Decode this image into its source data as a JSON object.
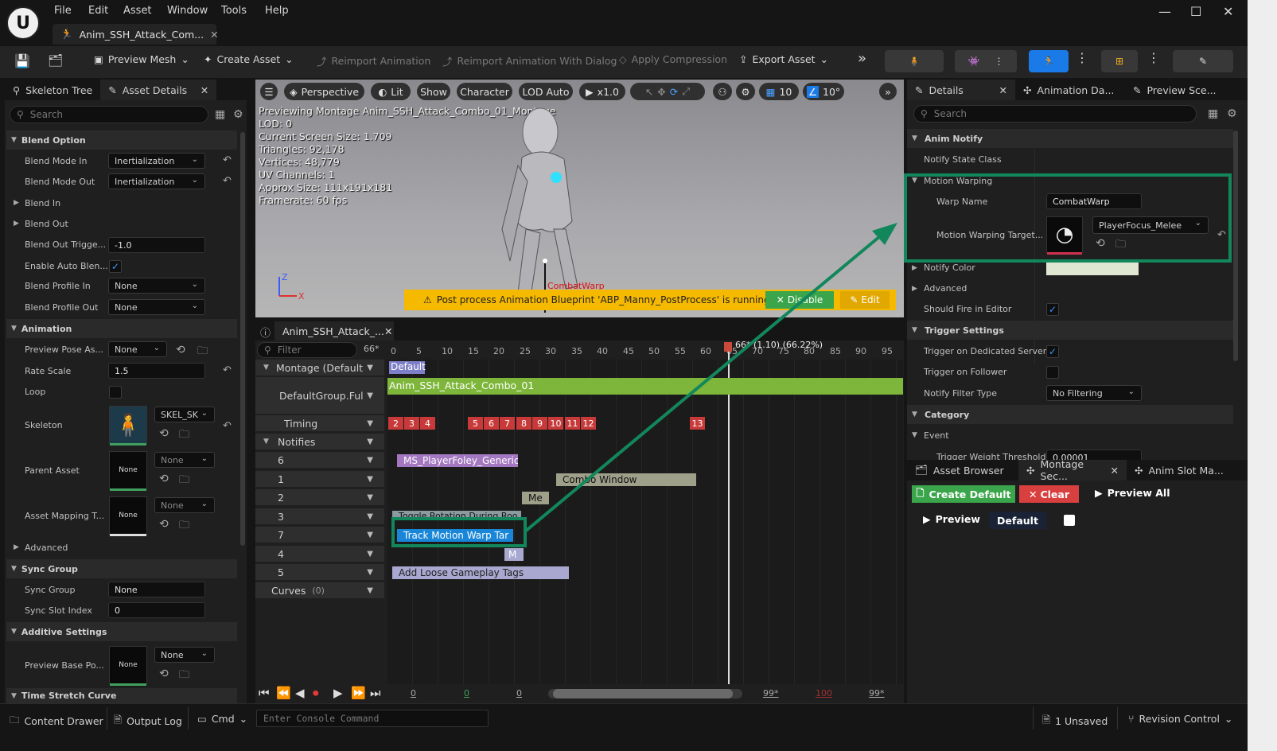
{
  "menu": [
    "File",
    "Edit",
    "Asset",
    "Window",
    "Tools",
    "Help"
  ],
  "doc_tab": "Anim_SSH_Attack_Com...",
  "toolbar": {
    "preview_mesh": "Preview Mesh",
    "create_asset": "Create Asset",
    "reimport": "Reimport Animation",
    "reimport_dialog": "Reimport Animation With Dialog",
    "apply_compression": "Apply Compression",
    "export_asset": "Export Asset"
  },
  "left_tabs": {
    "skeleton_tree": "Skeleton Tree",
    "asset_details": "Asset Details"
  },
  "left_search": "Search",
  "blend": {
    "cat": "Blend Option",
    "blend_mode_in": "Blend Mode In",
    "blend_mode_in_val": "Inertialization",
    "blend_mode_out": "Blend Mode Out",
    "blend_mode_out_val": "Inertialization",
    "blend_in": "Blend In",
    "blend_out": "Blend Out",
    "blend_out_trigger": "Blend Out Trigge...",
    "blend_out_trigger_val": "-1.0",
    "enable_auto": "Enable Auto Blen...",
    "profile_in": "Blend Profile In",
    "profile_in_val": "None",
    "profile_out": "Blend Profile Out",
    "profile_out_val": "None"
  },
  "animation": {
    "cat": "Animation",
    "preview_pose": "Preview Pose As...",
    "preview_pose_val": "None",
    "rate_scale": "Rate Scale",
    "rate_scale_val": "1.5",
    "loop": "Loop",
    "skeleton": "Skeleton",
    "skeleton_val": "SKEL_SK",
    "parent_asset": "Parent Asset",
    "parent_val": "None",
    "parent_thumb": "None",
    "mapping": "Asset Mapping T...",
    "mapping_val": "None",
    "mapping_thumb": "None",
    "advanced": "Advanced"
  },
  "sync": {
    "cat": "Sync Group",
    "sync_group": "Sync Group",
    "sync_group_val": "None",
    "sync_slot": "Sync Slot Index",
    "sync_slot_val": "0"
  },
  "additive": {
    "cat": "Additive Settings",
    "preview_base": "Preview Base Po...",
    "preview_base_val": "None",
    "preview_base_thumb": "None"
  },
  "time_stretch": "Time Stretch Curve",
  "viewport": {
    "perspective": "Perspective",
    "lit": "Lit",
    "show": "Show",
    "character": "Character",
    "lod": "LOD Auto",
    "speed": "x1.0",
    "grid": "10",
    "angle": "10°",
    "stats": [
      "Previewing Montage Anim_SSH_Attack_Combo_01_Montage",
      "LOD: 0",
      "Current Screen Size: 1.709",
      "Triangles: 92,178",
      "Vertices: 48,779",
      "UV Channels: 1",
      "Approx Size: 111x191x181",
      "Framerate: 60 fps"
    ],
    "warning": "Post process Animation Blueprint 'ABP_Manny_PostProcess' is running.",
    "disable": "Disable",
    "edit": "Edit",
    "bone_label": "CombatWarp"
  },
  "montage": {
    "tab": "Anim_SSH_Attack_...",
    "filter": "Filter",
    "frame_count": "66*",
    "playhead": "66* (1.10) (66.22%)",
    "ticks": [
      "0",
      "5",
      "10",
      "15",
      "20",
      "25",
      "30",
      "35",
      "40",
      "45",
      "50",
      "55",
      "60",
      "65",
      "70",
      "75",
      "80",
      "85",
      "90",
      "95"
    ],
    "tracks": {
      "montage": "Montage (Default",
      "group": "DefaultGroup.Ful",
      "timing": "Timing",
      "notifies": "Notifies",
      "n6": "6",
      "n1": "1",
      "n2": "2",
      "n3": "3",
      "n7": "7",
      "n4": "4",
      "n5": "5",
      "curves": "Curves",
      "curves_count": "(0)"
    },
    "default_label": "Default",
    "slot_anim": "Anim_SSH_Attack_Combo_01",
    "sections": [
      "2",
      "3",
      "4",
      "5",
      "6",
      "7",
      "8",
      "9",
      "10",
      "11",
      "12",
      "13"
    ],
    "notifies": {
      "n6": "MS_PlayerFoley_Generic",
      "n1": "Combo Window",
      "n2": "Me",
      "n3": "Toggle Rotation During Roo",
      "n7": "Track Motion Warp Tar",
      "n4": "M",
      "n5": "Add Loose Gameplay Tags"
    },
    "transport": {
      "start": "0",
      "green": "0",
      "mid": "0",
      "end1": "99*",
      "red": "100",
      "end2": "99*"
    }
  },
  "details": {
    "tabs": [
      "Details",
      "Animation Da...",
      "Preview Sce..."
    ],
    "search": "Search",
    "anim_notify": "Anim Notify",
    "notify_state_class": "Notify State Class",
    "motion_warping": "Motion Warping",
    "warp_name": "Warp Name",
    "warp_name_val": "CombatWarp",
    "warp_target": "Motion Warping Target...",
    "warp_target_val": "PlayerFocus_Melee",
    "notify_color": "Notify Color",
    "advanced": "Advanced",
    "fire_in_editor": "Should Fire in Editor",
    "trigger_settings": "Trigger Settings",
    "trigger_dedicated": "Trigger on Dedicated Server",
    "trigger_follower": "Trigger on Follower",
    "filter_type": "Notify Filter Type",
    "filter_type_val": "No Filtering",
    "category": "Category",
    "event": "Event",
    "weight_threshold": "Trigger Weight Threshold",
    "weight_val": "0.00001"
  },
  "asset_browser": {
    "tabs": [
      "Asset Browser",
      "Montage Sec...",
      "Anim Slot Ma..."
    ],
    "create_default": "Create Default",
    "clear": "Clear",
    "preview_all": "Preview All",
    "preview": "Preview",
    "default": "Default"
  },
  "status": {
    "content_drawer": "Content Drawer",
    "output_log": "Output Log",
    "cmd": "Cmd",
    "console": "Enter Console Command",
    "unsaved": "1 Unsaved",
    "revision": "Revision Control"
  },
  "colors": {
    "accent": "#1a7ae8",
    "highlight": "#13875c",
    "warning": "#f5b900",
    "section": "#c83a3a",
    "slot": "#7db63a"
  }
}
